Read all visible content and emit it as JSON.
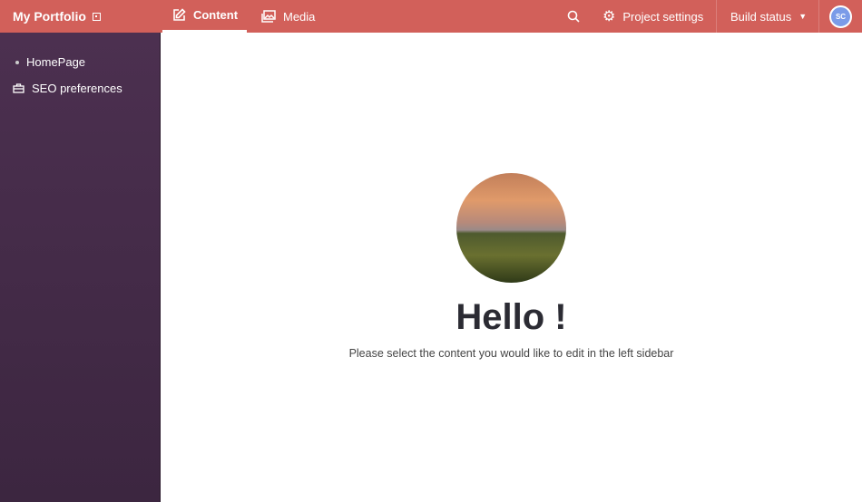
{
  "header": {
    "brand": "My Portfolio",
    "tabs": [
      {
        "label": "Content",
        "active": true
      },
      {
        "label": "Media"
      }
    ],
    "project_settings": "Project settings",
    "build_status": "Build status",
    "avatar": "SC"
  },
  "sidebar": {
    "items": [
      {
        "label": "HomePage",
        "icon": "bullet-icon"
      },
      {
        "label": "SEO preferences",
        "icon": "toolbox-icon"
      }
    ]
  },
  "main": {
    "title": "Hello !",
    "subtitle": "Please select the content you would like to edit in the left sidebar"
  },
  "colors": {
    "header": "#d2605a",
    "sidebar": "#45293f"
  }
}
